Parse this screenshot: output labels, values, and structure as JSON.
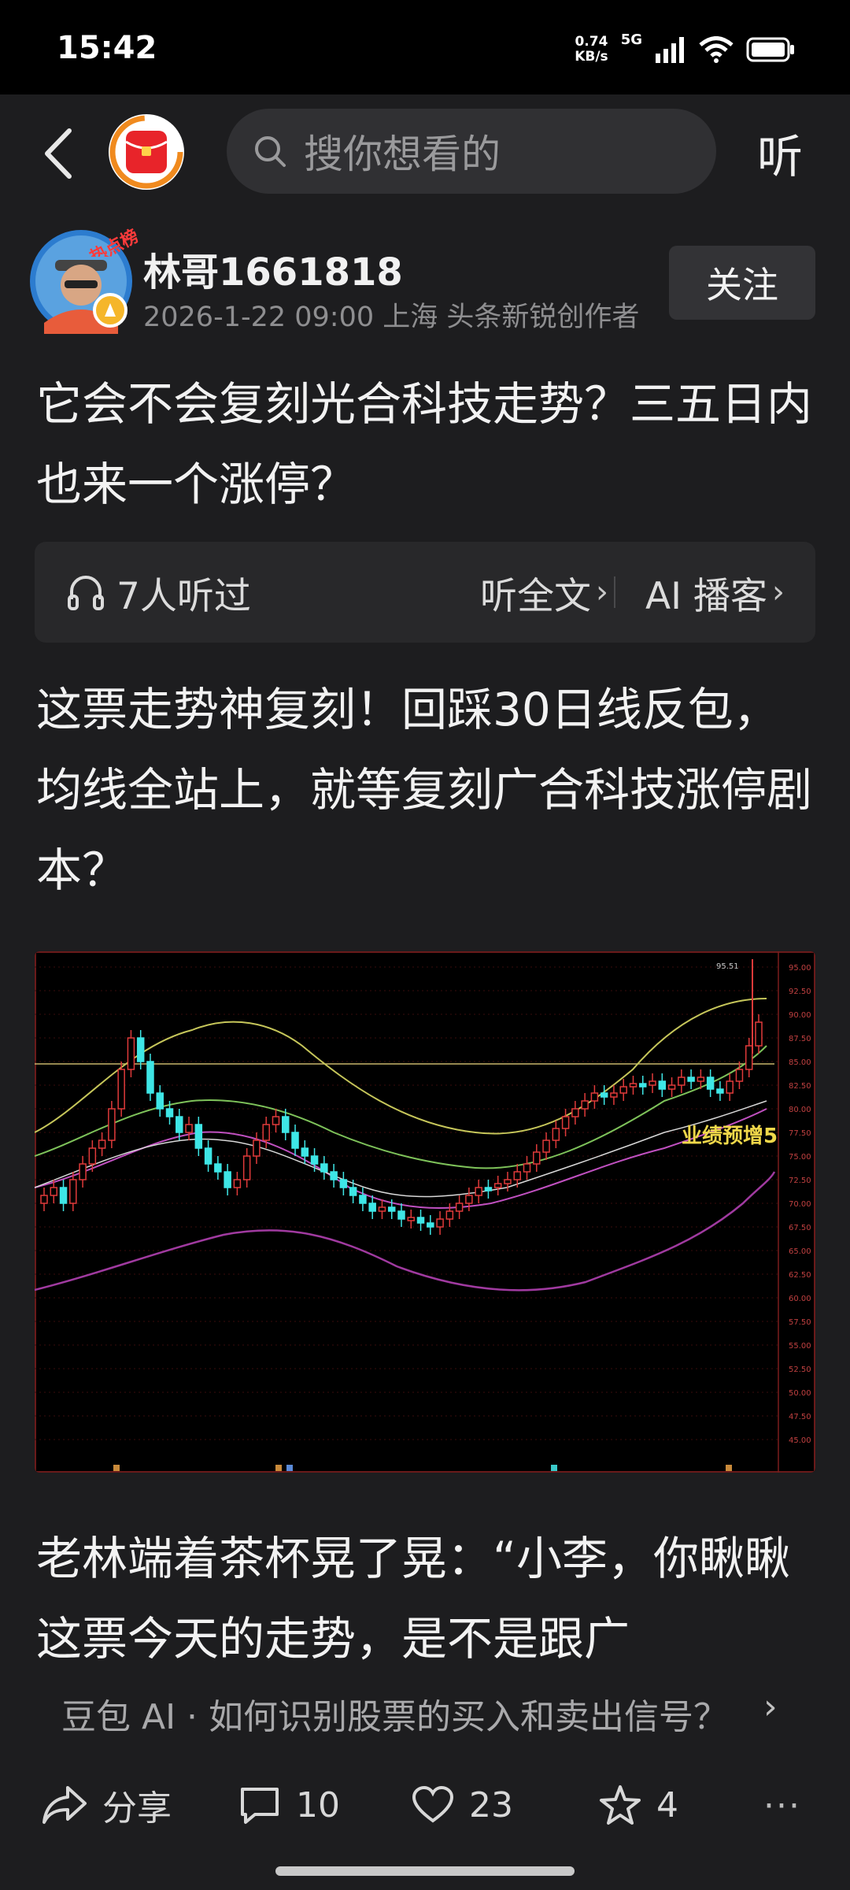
{
  "status_bar": {
    "time": "15:42",
    "net_speed_value": "0.74",
    "net_speed_unit": "KB/s",
    "network": "5G"
  },
  "top_bar": {
    "search_placeholder": "搜你想看的",
    "listen_label": "听"
  },
  "author": {
    "name": "林哥1661818",
    "badge": "热点榜",
    "meta": "2026-1-22  09:00  上海  头条新锐创作者",
    "follow_label": "关注"
  },
  "article": {
    "title": "它会不会复刻光合科技走势？三五日内也来一个涨停？",
    "listen_count": "7人听过",
    "listen_full_label": "听全文",
    "ai_podcast_label": "AI 播客",
    "lead": "这票走势神复刻！回踩30日线反包，均线全站上，就等复刻广合科技涨停剧本？",
    "body_preview": "老林端着茶杯晃了晃：“小李，你瞅瞅这票今天的走势，是不是跟广"
  },
  "chart_image": {
    "annotation": "业绩预增5",
    "peak_label": "95.51",
    "y_ticks": [
      "95.00",
      "92.50",
      "90.00",
      "87.50",
      "85.00",
      "82.50",
      "80.00",
      "77.50",
      "75.00",
      "72.50",
      "70.00",
      "67.50",
      "65.00",
      "62.50",
      "60.00",
      "57.50",
      "55.00",
      "52.50",
      "50.00",
      "47.50",
      "45.00"
    ]
  },
  "ai_suggestion": {
    "text": "豆包 AI · 如何识别股票的买入和卖出信号？"
  },
  "actions": {
    "share_label": "分享",
    "comments": "10",
    "likes": "23",
    "favorites": "4",
    "more": "···"
  },
  "colors": {
    "background": "#1d1d1f",
    "chart_bg": "#000000",
    "up": "#e03a3a",
    "down": "#3ee6e6"
  }
}
